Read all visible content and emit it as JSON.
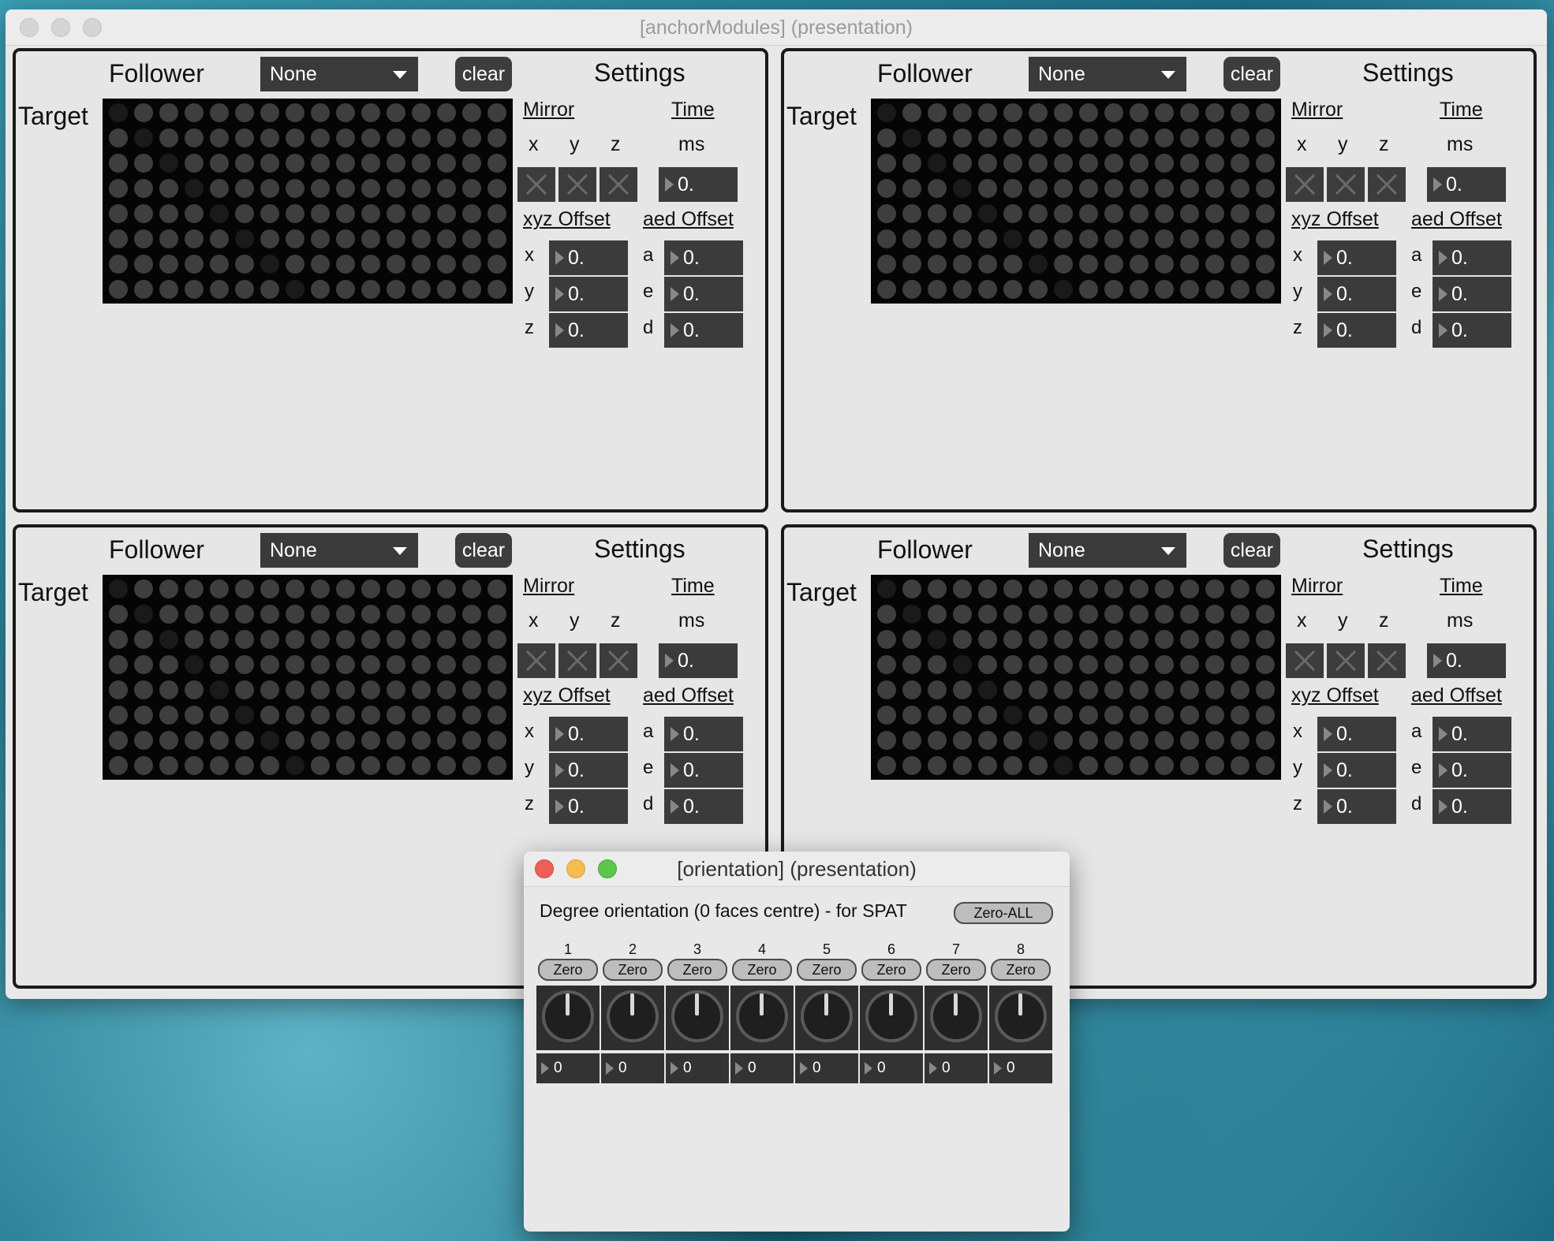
{
  "main_window": {
    "title": "[anchorModules] (presentation)"
  },
  "panel": {
    "follower_label": "Follower",
    "follower_value": "None",
    "clear_label": "clear",
    "settings_label": "Settings",
    "target_label": "Target",
    "mirror_label": "Mirror",
    "time_label": "Time",
    "axis_x": "x",
    "axis_y": "y",
    "axis_z": "z",
    "ms_label": "ms",
    "time_value": "0.",
    "xyz_offset_label": "xyz Offset",
    "aed_offset_label": "aed Offset",
    "axis_a": "a",
    "axis_e": "e",
    "axis_d": "d",
    "offset_value": "0."
  },
  "orientation_window": {
    "title": "[orientation] (presentation)",
    "heading": "Degree orientation (0 faces centre) - for SPAT",
    "zero_all_label": "Zero-ALL",
    "zero_label": "Zero",
    "channels": [
      {
        "num": "1",
        "value": "0"
      },
      {
        "num": "2",
        "value": "0"
      },
      {
        "num": "3",
        "value": "0"
      },
      {
        "num": "4",
        "value": "0"
      },
      {
        "num": "5",
        "value": "0"
      },
      {
        "num": "6",
        "value": "0"
      },
      {
        "num": "7",
        "value": "0"
      },
      {
        "num": "8",
        "value": "0"
      }
    ]
  },
  "colors": {
    "panel_bg": "#e6e6e6",
    "control_dark": "#3b3b3b",
    "matrix_bg": "#050505"
  },
  "icons": [
    "close-icon",
    "minimize-icon",
    "zoom-icon",
    "dropdown-caret-icon",
    "toggle-x-icon",
    "number-arrow-icon",
    "dial-icon"
  ]
}
